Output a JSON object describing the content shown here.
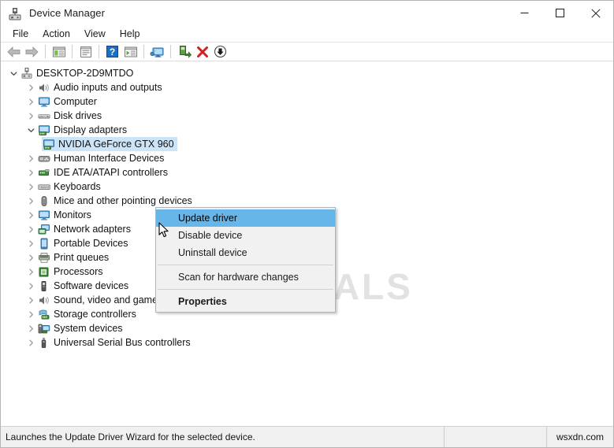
{
  "window": {
    "title": "Device Manager",
    "icon": "device-manager-icon",
    "controls": {
      "minimize": "minimize-icon",
      "maximize": "maximize-icon",
      "close": "close-icon"
    }
  },
  "menubar": {
    "items": [
      {
        "label": "File"
      },
      {
        "label": "Action"
      },
      {
        "label": "View"
      },
      {
        "label": "Help"
      }
    ]
  },
  "toolbar": {
    "buttons": [
      {
        "name": "back-button",
        "icon": "arrow-left-icon"
      },
      {
        "name": "forward-button",
        "icon": "arrow-right-icon"
      },
      {
        "name": "show-hide-console-tree-button",
        "icon": "console-tree-icon"
      },
      {
        "name": "properties-button",
        "icon": "properties-window-icon"
      },
      {
        "name": "help-button",
        "icon": "question-mark-icon"
      },
      {
        "name": "show-hidden-devices-button",
        "icon": "device-list-icon"
      },
      {
        "name": "scan-for-hardware-changes-button",
        "icon": "monitor-scan-icon"
      },
      {
        "name": "update-driver-button",
        "icon": "update-driver-icon"
      },
      {
        "name": "uninstall-device-button",
        "icon": "red-x-icon"
      },
      {
        "name": "disable-device-button",
        "icon": "down-arrow-circle-icon"
      }
    ]
  },
  "tree": {
    "nodes": [
      {
        "label": "DESKTOP-2D9MTDO",
        "level": 0,
        "expanded": true,
        "icon": "computer-root-icon",
        "selected": false
      },
      {
        "label": "Audio inputs and outputs",
        "level": 1,
        "expanded": false,
        "icon": "speaker-icon",
        "selected": false
      },
      {
        "label": "Computer",
        "level": 1,
        "expanded": false,
        "icon": "monitor-icon",
        "selected": false
      },
      {
        "label": "Disk drives",
        "level": 1,
        "expanded": false,
        "icon": "disk-drive-icon",
        "selected": false
      },
      {
        "label": "Display adapters",
        "level": 1,
        "expanded": true,
        "icon": "display-adapter-icon",
        "selected": false
      },
      {
        "label": "NVIDIA GeForce GTX 960",
        "level": 2,
        "expanded": null,
        "icon": "display-adapter-icon",
        "selected": true
      },
      {
        "label": "Human Interface Devices",
        "level": 1,
        "expanded": false,
        "icon": "hid-icon",
        "selected": false
      },
      {
        "label": "IDE ATA/ATAPI controllers",
        "level": 1,
        "expanded": false,
        "icon": "ide-controller-icon",
        "selected": false
      },
      {
        "label": "Keyboards",
        "level": 1,
        "expanded": false,
        "icon": "keyboard-icon",
        "selected": false
      },
      {
        "label": "Mice and other pointing devices",
        "level": 1,
        "expanded": false,
        "icon": "mouse-icon",
        "selected": false
      },
      {
        "label": "Monitors",
        "level": 1,
        "expanded": false,
        "icon": "monitor-icon",
        "selected": false
      },
      {
        "label": "Network adapters",
        "level": 1,
        "expanded": false,
        "icon": "network-adapter-icon",
        "selected": false
      },
      {
        "label": "Portable Devices",
        "level": 1,
        "expanded": false,
        "icon": "portable-device-icon",
        "selected": false
      },
      {
        "label": "Print queues",
        "level": 1,
        "expanded": false,
        "icon": "printer-icon",
        "selected": false
      },
      {
        "label": "Processors",
        "level": 1,
        "expanded": false,
        "icon": "processor-icon",
        "selected": false
      },
      {
        "label": "Software devices",
        "level": 1,
        "expanded": false,
        "icon": "software-device-icon",
        "selected": false
      },
      {
        "label": "Sound, video and game controllers",
        "level": 1,
        "expanded": false,
        "icon": "speaker-icon",
        "selected": false
      },
      {
        "label": "Storage controllers",
        "level": 1,
        "expanded": false,
        "icon": "storage-controller-icon",
        "selected": false
      },
      {
        "label": "System devices",
        "level": 1,
        "expanded": false,
        "icon": "system-device-icon",
        "selected": false
      },
      {
        "label": "Universal Serial Bus controllers",
        "level": 1,
        "expanded": false,
        "icon": "usb-icon",
        "selected": false
      }
    ]
  },
  "context_menu": {
    "items": [
      {
        "label": "Update driver",
        "highlight": true,
        "bold": false,
        "separator_after": false
      },
      {
        "label": "Disable device",
        "highlight": false,
        "bold": false,
        "separator_after": false
      },
      {
        "label": "Uninstall device",
        "highlight": false,
        "bold": false,
        "separator_after": true
      },
      {
        "label": "Scan for hardware changes",
        "highlight": false,
        "bold": false,
        "separator_after": true
      },
      {
        "label": "Properties",
        "highlight": false,
        "bold": true,
        "separator_after": false
      }
    ]
  },
  "statusbar": {
    "message": "Launches the Update Driver Wizard for the selected device.",
    "middle": "",
    "right": "wsxdn.com"
  },
  "watermark": {
    "text": "APPUALS"
  },
  "colors": {
    "selection_blue": "#cce4f7",
    "menu_highlight": "#67b6ea",
    "accent_red": "#d32020",
    "watermark_gray": "#e2e2e2",
    "statusbar_bg": "#f0f0f0"
  }
}
